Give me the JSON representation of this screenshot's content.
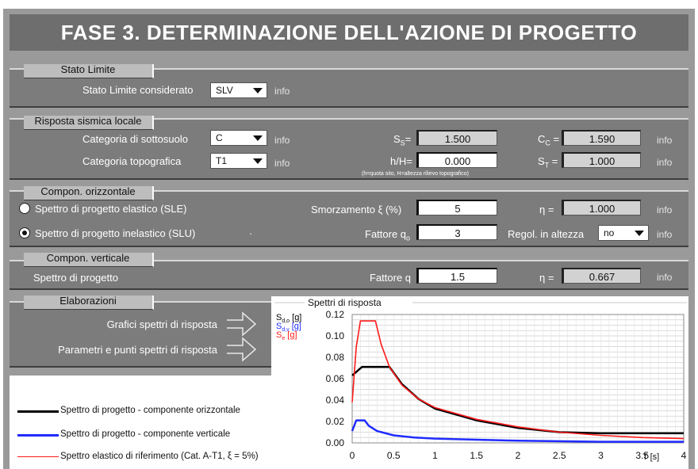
{
  "title": "FASE 3. DETERMINAZIONE DELL'AZIONE DI PROGETTO",
  "stato_limite": {
    "header": "Stato Limite",
    "label": "Stato Limite considerato",
    "value": "SLV",
    "info": "info"
  },
  "risposta": {
    "header": "Risposta sismica locale",
    "cat_sottosuolo_label": "Categoria di sottosuolo",
    "cat_sottosuolo_value": "C",
    "cat_topo_label": "Categoria topografica",
    "cat_topo_value": "T1",
    "ss_sub": "S",
    "ss_subscript": "S",
    "ss_value": "1.500",
    "cc_sub": "C",
    "cc_subscript": "C",
    "cc_value": "1.590",
    "hH_label": "h/H=",
    "hH_value": "0.000",
    "hH_note": "(h=quota sito, H=altezza rilievo topografico)",
    "st_sub": "S",
    "st_subscript": "T",
    "st_value": "1.000",
    "info": "info"
  },
  "orizzontale": {
    "header": "Compon. orizzontale",
    "radio1": "Spettro di progetto elastico (SLE)",
    "radio2": "Spettro di progetto inelastico (SLU)",
    "smorz_label": "Smorzamento  ξ (%)",
    "smorz_value": "5",
    "eta_label": "η =",
    "eta_value": "1.000",
    "fattore_label": "Fattore q",
    "fattore_sub": "o",
    "fattore_value": "3",
    "regol_label": "Regol. in altezza",
    "regol_value": "no",
    "dot": "·",
    "info": "info"
  },
  "verticale": {
    "header": "Compon. verticale",
    "label": "Spettro di progetto",
    "fattore_label": "Fattore q",
    "fattore_value": "1.5",
    "eta_label": "η =",
    "eta_value": "0.667",
    "info": "info"
  },
  "elaborazioni": {
    "header": "Elaborazioni",
    "btn1": "Grafici spettri di risposta",
    "btn2": "Parametri e punti spettri di risposta"
  },
  "legend": {
    "item1": "Spettro di progetto - componente orizzontale",
    "item2": "Spettro di progetto - componente verticale",
    "item3": "Spettro elastico di riferimento (Cat. A-T1, ξ = 5%)"
  },
  "colors": {
    "horizontal": "#000000",
    "vertical": "#1f2bff",
    "elastic": "#ff1a1a"
  },
  "chart_data": {
    "type": "line",
    "title": "Spettri di risposta",
    "ylabels": [
      {
        "main": "S",
        "sub": "d,o",
        "unit": " [g]"
      },
      {
        "main": "S",
        "sub": "d,v",
        "unit": " [g]"
      },
      {
        "main": "S",
        "sub": "e",
        "unit": " [g]"
      }
    ],
    "xlabel": "T [s]",
    "xlim": [
      0,
      4
    ],
    "ylim": [
      0,
      0.12
    ],
    "xticks": [
      "0",
      "0.5",
      "1",
      "1.5",
      "2",
      "2.5",
      "3",
      "3.5",
      "4"
    ],
    "yticks": [
      "0.00",
      "0.02",
      "0.04",
      "0.06",
      "0.08",
      "0.10",
      "0.12"
    ],
    "grid": true,
    "series": [
      {
        "name": "Spettro di progetto - componente orizzontale",
        "color": "#000000",
        "x": [
          0,
          0.12,
          0.45,
          0.6,
          0.8,
          1.0,
          1.5,
          2.0,
          2.5,
          3.0,
          3.5,
          4.0
        ],
        "y": [
          0.063,
          0.071,
          0.071,
          0.055,
          0.041,
          0.032,
          0.021,
          0.014,
          0.01,
          0.009,
          0.009,
          0.009
        ]
      },
      {
        "name": "Spettro di progetto - componente verticale",
        "color": "#1f2bff",
        "x": [
          0,
          0.05,
          0.15,
          0.2,
          0.3,
          0.5,
          0.75,
          1.0,
          1.5,
          2.0,
          3.0,
          4.0
        ],
        "y": [
          0.011,
          0.021,
          0.021,
          0.016,
          0.011,
          0.007,
          0.005,
          0.004,
          0.003,
          0.002,
          0.001,
          0.001
        ]
      },
      {
        "name": "Spettro elastico di riferimento (Cat. A-T1, ξ = 5%)",
        "color": "#ff1a1a",
        "x": [
          0,
          0.05,
          0.1,
          0.28,
          0.35,
          0.45,
          0.6,
          0.8,
          1.0,
          1.5,
          2.0,
          2.5,
          3.0,
          3.5,
          4.0
        ],
        "y": [
          0.038,
          0.09,
          0.114,
          0.114,
          0.092,
          0.071,
          0.054,
          0.041,
          0.033,
          0.022,
          0.015,
          0.01,
          0.007,
          0.005,
          0.004
        ]
      }
    ]
  }
}
